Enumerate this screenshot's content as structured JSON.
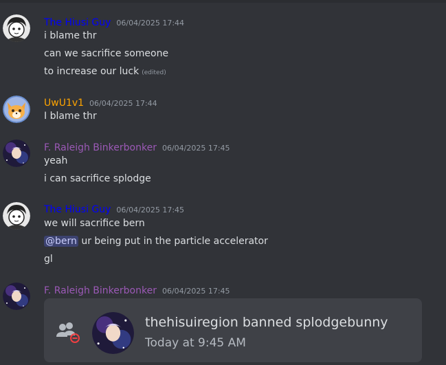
{
  "colors": {
    "background": "#313338",
    "hiusi_name": "#0000ff",
    "uwu_name": "#ffa500",
    "raleigh_name": "#9b59b6",
    "timestamp": "#949ba4",
    "mention_bg": "#3c4270"
  },
  "messages": [
    {
      "author": "The Hiusi Guy",
      "timestamp": "06/04/2025 17:44",
      "avatar_icon": "bw-anime-avatar",
      "lines": [
        "i blame thr",
        "can we sacrifice someone",
        "to increase our luck"
      ],
      "edited_label": "(edited)"
    },
    {
      "author": "UwU1v1",
      "timestamp": "06/04/2025 17:44",
      "avatar_icon": "fox-avatar",
      "lines": [
        "I blame thr"
      ]
    },
    {
      "author": "F. Raleigh Binkerbonker",
      "timestamp": "06/04/2025 17:45",
      "avatar_icon": "galaxy-character-avatar",
      "lines": [
        "yeah",
        "i can sacrifice splodge"
      ]
    },
    {
      "author": "The Hiusi Guy",
      "timestamp": "06/04/2025 17:45",
      "avatar_icon": "bw-anime-avatar",
      "lines": [
        "we will sacrifice bern",
        "ur being put in the particle accelerator",
        "gl"
      ],
      "mention": "@bern"
    },
    {
      "author": "F. Raleigh Binkerbonker",
      "timestamp": "06/04/2025 17:45",
      "avatar_icon": "galaxy-character-avatar"
    }
  ],
  "embed": {
    "icon": "user-ban-icon",
    "title": "thehisuiregion banned splodgebunny",
    "subtitle": "Today at 9:45 AM"
  }
}
